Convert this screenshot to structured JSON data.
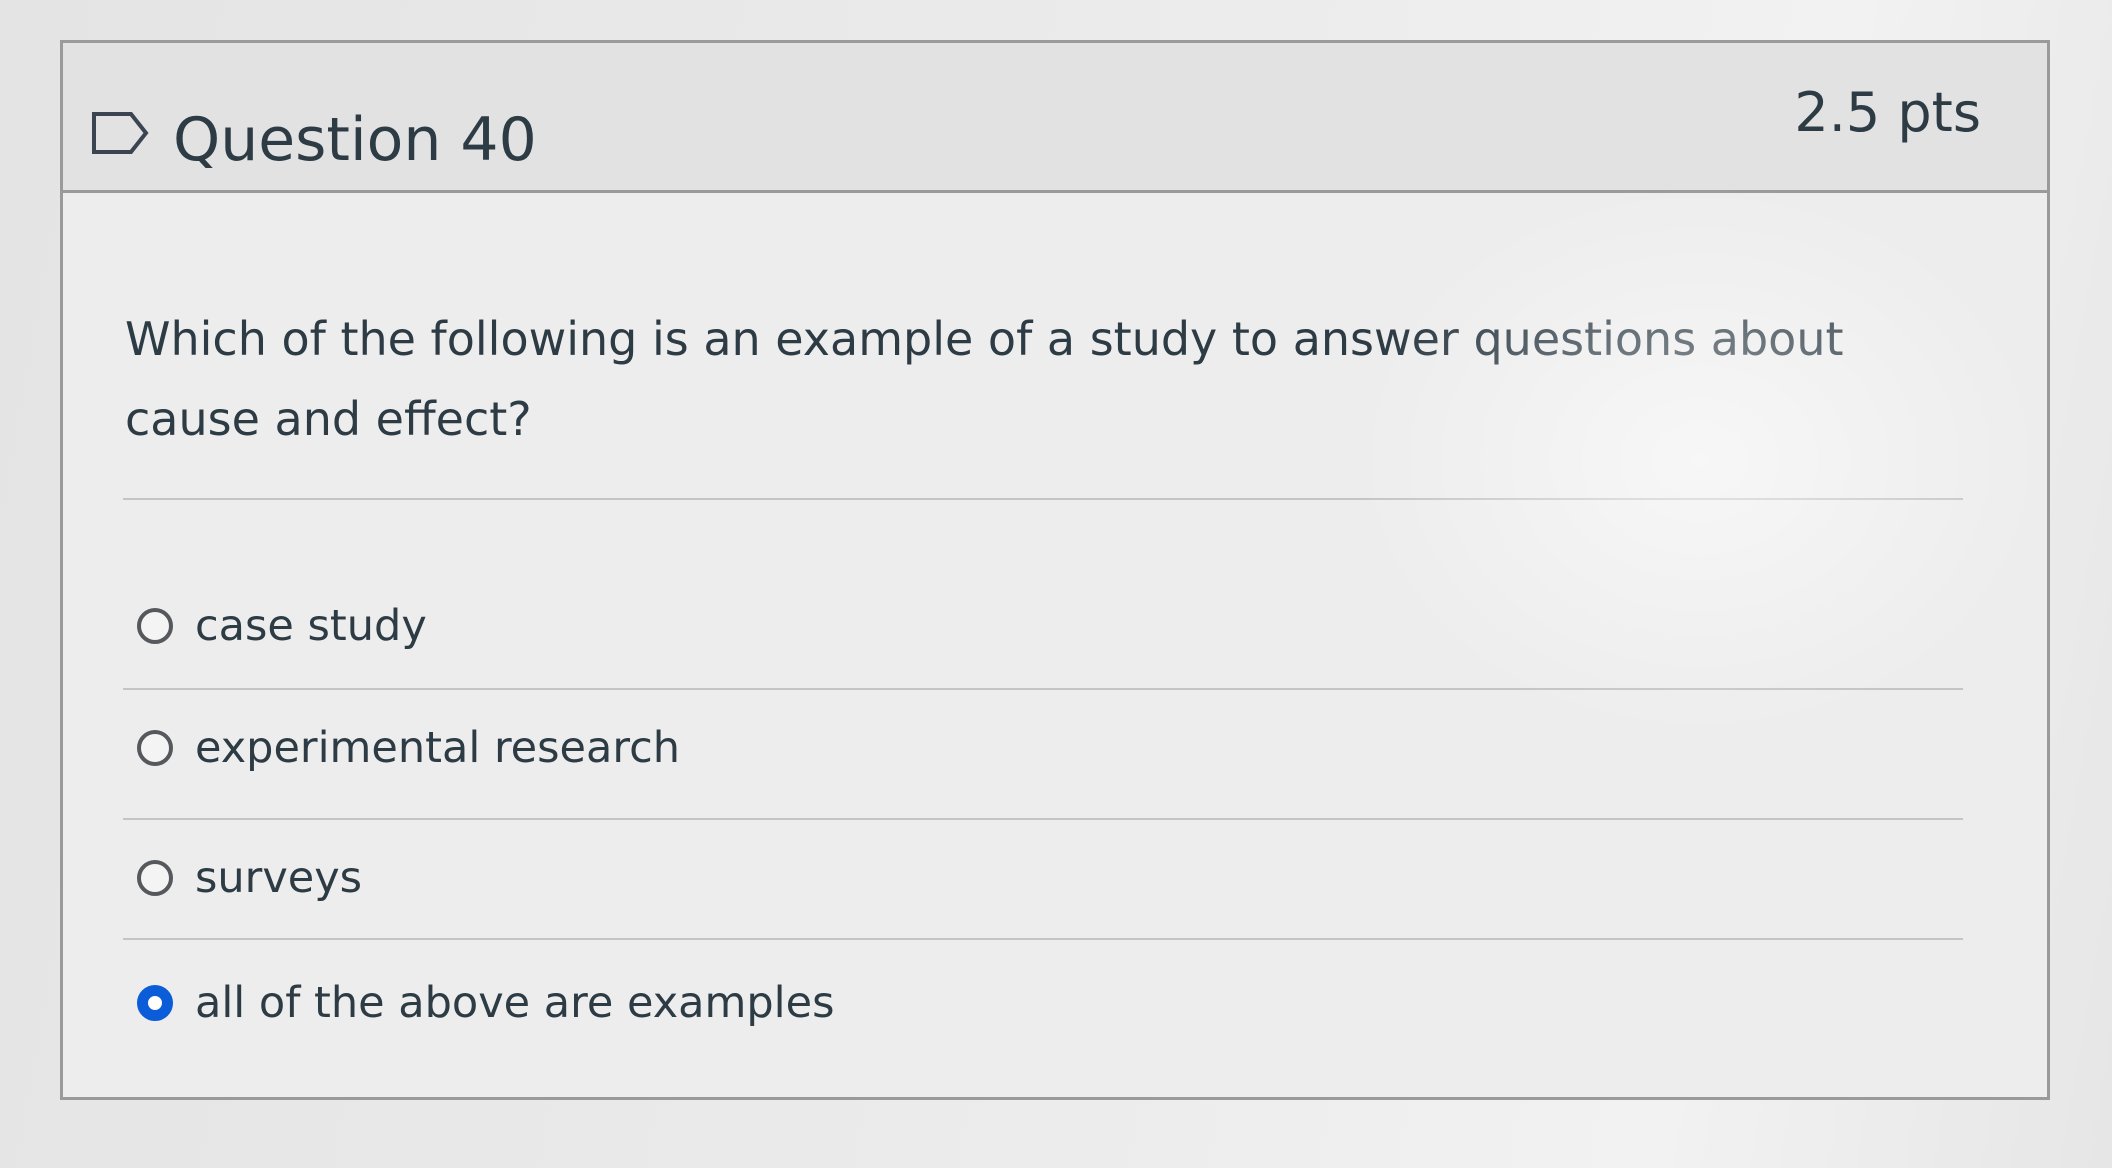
{
  "question": {
    "title": "Question 40",
    "points": "2.5 pts",
    "flag_icon": "flag-outline-icon",
    "text": "Which of the following is an example of a study to answer questions about cause and effect?"
  },
  "answers": [
    {
      "label": "case study",
      "selected": false
    },
    {
      "label": "experimental research",
      "selected": false
    },
    {
      "label": "surveys",
      "selected": false
    },
    {
      "label": "all of the above are examples",
      "selected": true
    }
  ],
  "colors": {
    "selected_radio": "#0b5cd8",
    "text": "#2d3b45",
    "border": "#9a9a9a"
  }
}
